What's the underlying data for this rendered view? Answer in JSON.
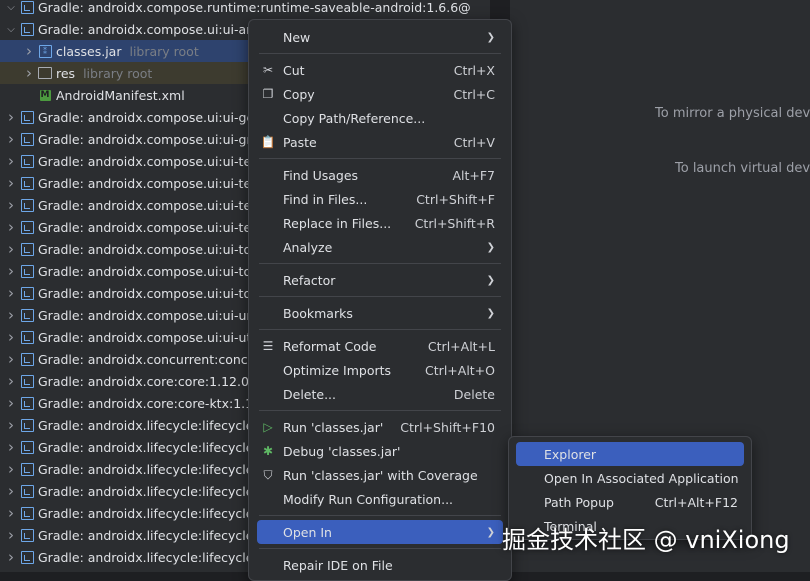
{
  "tree": {
    "rows": [
      {
        "arrow": "down",
        "icon": "lib",
        "label": "Gradle: androidx.compose.runtime:runtime-saveable-android:1.6.6@",
        "hint": "",
        "indent": 0,
        "state": ""
      },
      {
        "arrow": "down",
        "icon": "lib",
        "label": "Gradle: androidx.compose.ui:ui-android",
        "hint": "",
        "indent": 0,
        "state": ""
      },
      {
        "arrow": "right",
        "icon": "jar",
        "label": "classes.jar",
        "hint": "library root",
        "indent": 1,
        "state": "selected"
      },
      {
        "arrow": "right",
        "icon": "folder",
        "label": "res",
        "hint": "library root",
        "indent": 1,
        "state": "excluded"
      },
      {
        "arrow": "",
        "icon": "xml",
        "label": "AndroidManifest.xml",
        "hint": "",
        "indent": 1,
        "state": ""
      },
      {
        "arrow": "right",
        "icon": "lib",
        "label": "Gradle: androidx.compose.ui:ui-geo",
        "hint": "",
        "indent": 0,
        "state": ""
      },
      {
        "arrow": "right",
        "icon": "lib",
        "label": "Gradle: androidx.compose.ui:ui-gra",
        "hint": "",
        "indent": 0,
        "state": ""
      },
      {
        "arrow": "right",
        "icon": "lib",
        "label": "Gradle: androidx.compose.ui:ui-test",
        "hint": "",
        "indent": 0,
        "state": ""
      },
      {
        "arrow": "right",
        "icon": "lib",
        "label": "Gradle: androidx.compose.ui:ui-test",
        "hint": "",
        "indent": 0,
        "state": ""
      },
      {
        "arrow": "right",
        "icon": "lib",
        "label": "Gradle: androidx.compose.ui:ui-test",
        "hint": "",
        "indent": 0,
        "state": ""
      },
      {
        "arrow": "right",
        "icon": "lib",
        "label": "Gradle: androidx.compose.ui:ui-text",
        "hint": "",
        "indent": 0,
        "state": ""
      },
      {
        "arrow": "right",
        "icon": "lib",
        "label": "Gradle: androidx.compose.ui:ui-too",
        "hint": "",
        "indent": 0,
        "state": ""
      },
      {
        "arrow": "right",
        "icon": "lib",
        "label": "Gradle: androidx.compose.ui:ui-too",
        "hint": "",
        "indent": 0,
        "state": ""
      },
      {
        "arrow": "right",
        "icon": "lib",
        "label": "Gradle: androidx.compose.ui:ui-too",
        "hint": "",
        "indent": 0,
        "state": ""
      },
      {
        "arrow": "right",
        "icon": "lib",
        "label": "Gradle: androidx.compose.ui:ui-unit",
        "hint": "",
        "indent": 0,
        "state": ""
      },
      {
        "arrow": "right",
        "icon": "lib",
        "label": "Gradle: androidx.compose.ui:ui-util-",
        "hint": "",
        "indent": 0,
        "state": ""
      },
      {
        "arrow": "right",
        "icon": "lib",
        "label": "Gradle: androidx.concurrent:concur",
        "hint": "",
        "indent": 0,
        "state": ""
      },
      {
        "arrow": "right",
        "icon": "lib",
        "label": "Gradle: androidx.core:core:1.12.0@a",
        "hint": "",
        "indent": 0,
        "state": ""
      },
      {
        "arrow": "right",
        "icon": "lib",
        "label": "Gradle: androidx.core:core-ktx:1.12.",
        "hint": "",
        "indent": 0,
        "state": ""
      },
      {
        "arrow": "right",
        "icon": "lib",
        "label": "Gradle: androidx.lifecycle:lifecycle-co",
        "hint": "",
        "indent": 0,
        "state": ""
      },
      {
        "arrow": "right",
        "icon": "lib",
        "label": "Gradle: androidx.lifecycle:lifecycle-liv",
        "hint": "",
        "indent": 0,
        "state": ""
      },
      {
        "arrow": "right",
        "icon": "lib",
        "label": "Gradle: androidx.lifecycle:lifecycle-ru",
        "hint": "",
        "indent": 0,
        "state": ""
      },
      {
        "arrow": "right",
        "icon": "lib",
        "label": "Gradle: androidx.lifecycle:lifecycle-ru",
        "hint": "",
        "indent": 0,
        "state": ""
      },
      {
        "arrow": "right",
        "icon": "lib",
        "label": "Gradle: androidx.lifecycle:lifecycle-vi",
        "hint": "",
        "indent": 0,
        "state": ""
      },
      {
        "arrow": "right",
        "icon": "lib",
        "label": "Gradle: androidx.lifecycle:lifecycle-vi",
        "hint": "",
        "indent": 0,
        "state": ""
      },
      {
        "arrow": "right",
        "icon": "lib",
        "label": "Gradle: androidx.lifecycle:lifecycle-vi",
        "hint": "",
        "indent": 0,
        "state": ""
      }
    ]
  },
  "emulator": {
    "mirror_text": "To mirror a physical devic",
    "launch_text": "To launch virtual devic"
  },
  "menu": {
    "items": [
      {
        "label": "New",
        "mnemonic": "N",
        "shortcut": "",
        "icon": "",
        "submenu": true
      },
      {
        "sep": true
      },
      {
        "label": "Cut",
        "shortcut": "Ctrl+X",
        "icon": "✂",
        "submenu": false
      },
      {
        "label": "Copy",
        "shortcut": "Ctrl+C",
        "icon": "❐",
        "submenu": false
      },
      {
        "label": "Copy Path/Reference...",
        "shortcut": "",
        "icon": "",
        "submenu": false
      },
      {
        "label": "Paste",
        "shortcut": "Ctrl+V",
        "icon": "📋",
        "submenu": false
      },
      {
        "sep": true
      },
      {
        "label": "Find Usages",
        "shortcut": "Alt+F7",
        "icon": "",
        "submenu": false
      },
      {
        "label": "Find in Files...",
        "shortcut": "Ctrl+Shift+F",
        "icon": "",
        "submenu": false
      },
      {
        "label": "Replace in Files...",
        "shortcut": "Ctrl+Shift+R",
        "icon": "",
        "submenu": false
      },
      {
        "label": "Analyze",
        "shortcut": "",
        "icon": "",
        "submenu": true
      },
      {
        "sep": true
      },
      {
        "label": "Refactor",
        "shortcut": "",
        "icon": "",
        "submenu": true
      },
      {
        "sep": true
      },
      {
        "label": "Bookmarks",
        "shortcut": "",
        "icon": "",
        "submenu": true
      },
      {
        "sep": true
      },
      {
        "label": "Reformat Code",
        "shortcut": "Ctrl+Alt+L",
        "icon": "☰",
        "submenu": false
      },
      {
        "label": "Optimize Imports",
        "shortcut": "Ctrl+Alt+O",
        "icon": "",
        "submenu": false
      },
      {
        "label": "Delete...",
        "shortcut": "Delete",
        "icon": "",
        "submenu": false
      },
      {
        "sep": true
      },
      {
        "label": "Run 'classes.jar'",
        "shortcut": "Ctrl+Shift+F10",
        "icon": "▷",
        "submenu": false
      },
      {
        "label": "Debug 'classes.jar'",
        "shortcut": "",
        "icon": "✱",
        "submenu": false
      },
      {
        "label": "Run 'classes.jar' with Coverage",
        "shortcut": "",
        "icon": "⛉",
        "submenu": false
      },
      {
        "label": "Modify Run Configuration...",
        "shortcut": "",
        "icon": "",
        "submenu": false
      },
      {
        "sep": true
      },
      {
        "label": "Open In",
        "shortcut": "",
        "icon": "",
        "submenu": true,
        "active": true
      },
      {
        "sep": true
      },
      {
        "label": "Repair IDE on File",
        "shortcut": "",
        "icon": "",
        "submenu": false
      }
    ]
  },
  "submenu": {
    "items": [
      {
        "label": "Explorer",
        "shortcut": "",
        "active": true
      },
      {
        "label": "Open In Associated Application",
        "shortcut": "",
        "active": false
      },
      {
        "label": "Path Popup",
        "shortcut": "Ctrl+Alt+F12",
        "active": false
      },
      {
        "label": "Terminal",
        "shortcut": "",
        "active": false
      }
    ]
  },
  "watermark": "掘金技术社区 @ vniXiong",
  "colors": {
    "accent": "#3b5fbd",
    "selection": "#2e436e",
    "background": "#2b2d30"
  }
}
